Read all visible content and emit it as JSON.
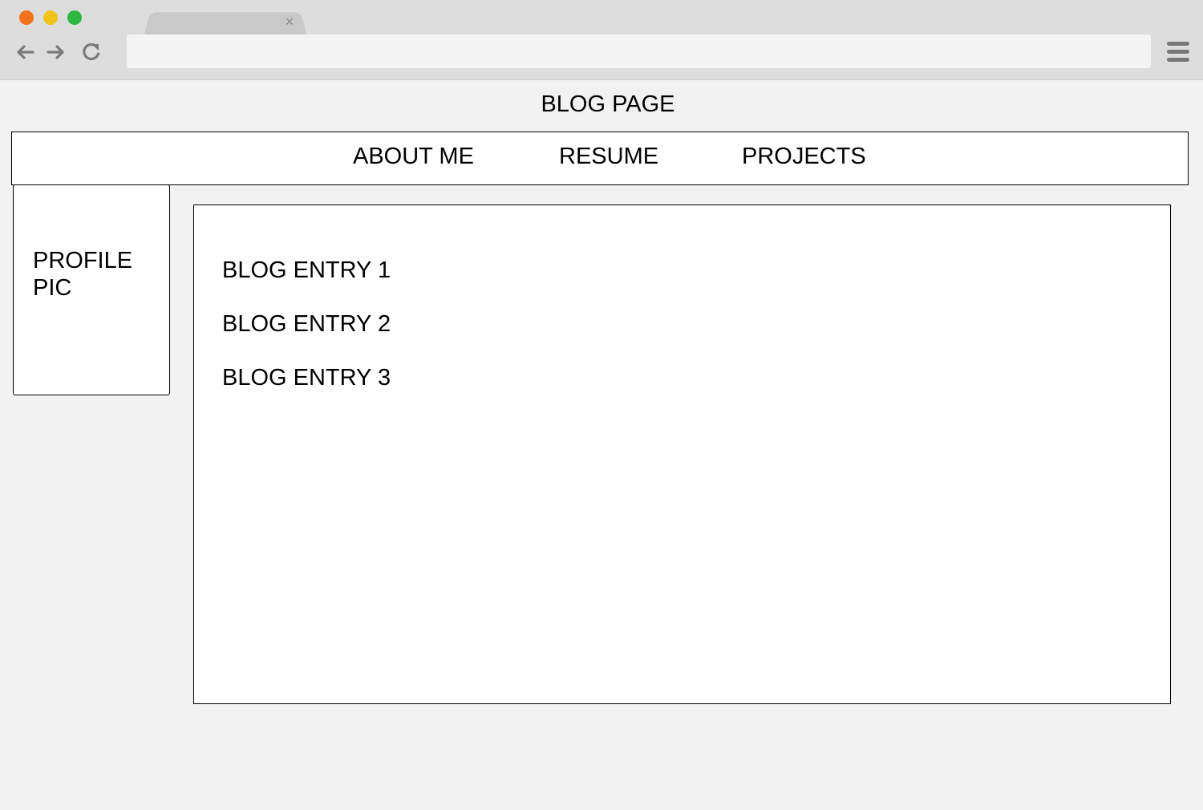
{
  "browser": {
    "tab": {
      "title": "",
      "close_icon": "×"
    },
    "address_bar": {
      "value": ""
    },
    "traffic_lights": {
      "close": "#f1731b",
      "minimize": "#f0c419",
      "maximize": "#2db842"
    },
    "icons": [
      "back-arrow-icon",
      "forward-arrow-icon",
      "reload-icon",
      "hamburger-menu-icon"
    ]
  },
  "page": {
    "title": "BLOG PAGE",
    "nav": {
      "items": [
        {
          "label": "ABOUT ME"
        },
        {
          "label": "RESUME"
        },
        {
          "label": "PROJECTS"
        }
      ]
    },
    "profile": {
      "label": "PROFILE PIC"
    },
    "blog": {
      "entries": [
        {
          "label": "BLOG ENTRY 1"
        },
        {
          "label": "BLOG ENTRY 2"
        },
        {
          "label": "BLOG ENTRY 3"
        }
      ]
    }
  }
}
